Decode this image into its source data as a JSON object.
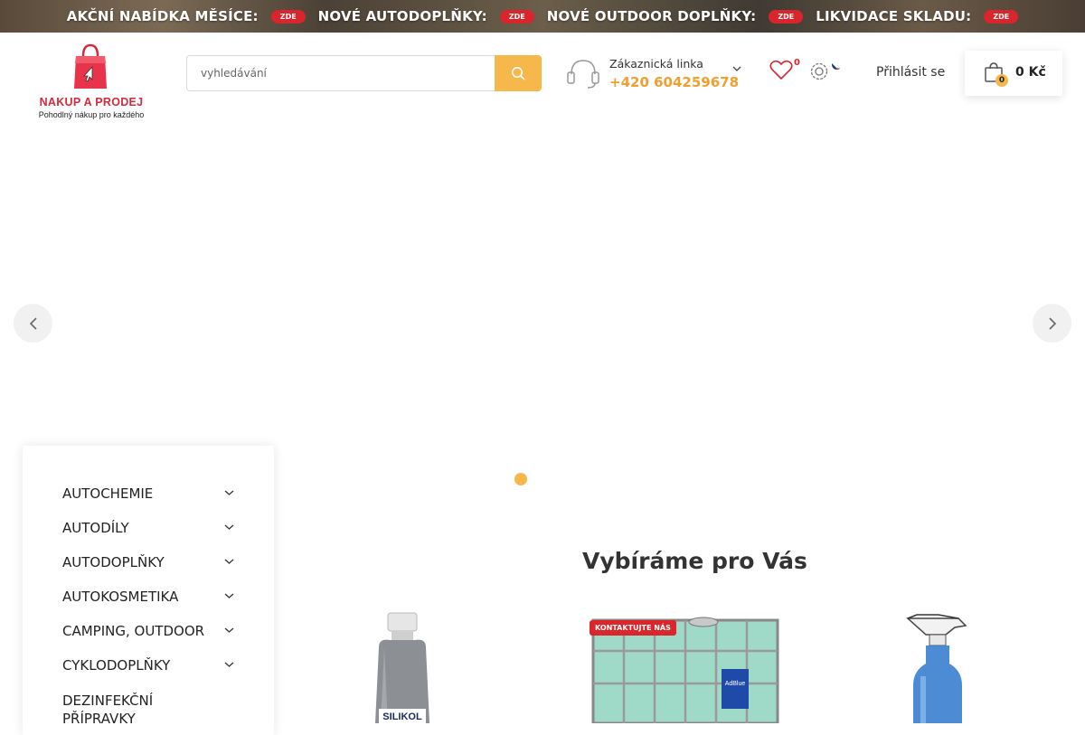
{
  "promo_bar": {
    "items": [
      {
        "label": "AKČNÍ NABÍDKA MĚSÍCE:",
        "badge": "ZDE"
      },
      {
        "label": "NOVÉ AUTODOPLŇKY:",
        "badge": "ZDE"
      },
      {
        "label": "NOVÉ OUTDOOR DOPLŇKY:",
        "badge": "ZDE"
      },
      {
        "label": "LIKVIDACE SKLADU:",
        "badge": "ZDE"
      }
    ]
  },
  "logo": {
    "title": "NAKUP A PRODEJ",
    "subtitle": "Pohodlný nákup pro každého"
  },
  "search": {
    "placeholder": "vyhledávání"
  },
  "hotline": {
    "label": "Zákaznická linka",
    "phone": "+420 604259678"
  },
  "wishlist": {
    "count": "0"
  },
  "login": {
    "label": "Přihlásit se"
  },
  "cart": {
    "count": "0",
    "total": "0 Kč"
  },
  "categories": [
    "AUTOCHEMIE",
    "AUTODÍLY",
    "AUTODOPLŇKY",
    "AUTOKOSMETIKA",
    "CAMPING, OUTDOOR",
    "CYKLODOPLŇKY",
    "DEZINFEKČNÍ PŘÍPRAVKY"
  ],
  "recommend": {
    "title": "Vybíráme pro Vás",
    "badge": "KONTAKTUJTE NÁS",
    "products": [
      {
        "label": "SILIKOL"
      },
      {
        "label": "AdBlue"
      }
    ]
  },
  "colors": {
    "accent": "#f6b84a",
    "badge_red": "#d9252b",
    "brand_red": "#d42a3a"
  }
}
